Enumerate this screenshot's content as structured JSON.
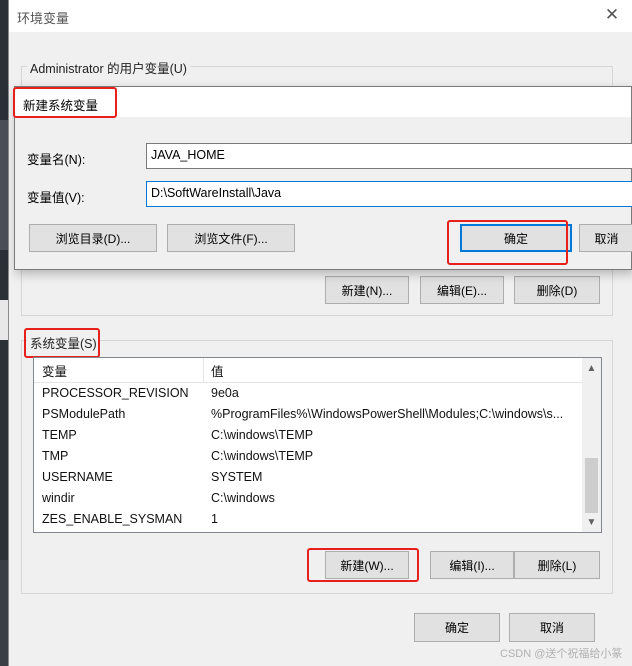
{
  "main_window": {
    "title": "环境变量",
    "user_group_label": "Administrator 的用户变量(U)",
    "user_buttons": {
      "new": "新建(N)...",
      "edit": "编辑(E)...",
      "delete": "删除(D)"
    },
    "system_group_label": "系统变量(S)",
    "system_table": {
      "columns": [
        "变量",
        "值"
      ],
      "rows": [
        {
          "name": "PROCESSOR_REVISION",
          "value": "9e0a"
        },
        {
          "name": "PSModulePath",
          "value": "%ProgramFiles%\\WindowsPowerShell\\Modules;C:\\windows\\s..."
        },
        {
          "name": "TEMP",
          "value": "C:\\windows\\TEMP"
        },
        {
          "name": "TMP",
          "value": "C:\\windows\\TEMP"
        },
        {
          "name": "USERNAME",
          "value": "SYSTEM"
        },
        {
          "name": "windir",
          "value": "C:\\windows"
        },
        {
          "name": "ZES_ENABLE_SYSMAN",
          "value": "1"
        }
      ]
    },
    "system_buttons": {
      "new": "新建(W)...",
      "edit": "编辑(I)...",
      "delete": "删除(L)"
    },
    "footer_buttons": {
      "ok": "确定",
      "cancel": "取消"
    }
  },
  "dialog": {
    "title": "新建系统变量",
    "name_label": "变量名(N):",
    "name_value": "JAVA_HOME",
    "value_label": "变量值(V):",
    "value_value": "D:\\SoftWareInstall\\Java",
    "browse_dir": "浏览目录(D)...",
    "browse_file": "浏览文件(F)...",
    "ok": "确定",
    "cancel": "取消"
  },
  "watermark": "CSDN @送个祝福给小篆",
  "icons": {
    "close": "close-icon",
    "scroll_up": "chevron-up-icon",
    "scroll_down": "chevron-down-icon"
  },
  "colors": {
    "highlight": "#e8201b",
    "focus": "#0078d7"
  }
}
